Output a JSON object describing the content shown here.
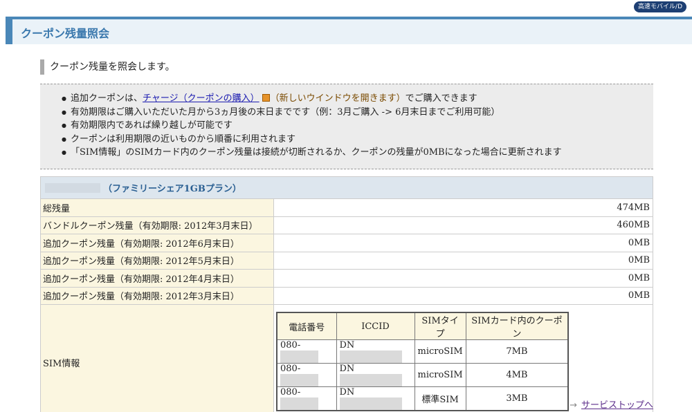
{
  "header": {
    "badge": "高速モバイル/D",
    "title": "クーポン残量照会"
  },
  "intro": "クーポン残量を照会します。",
  "notes": {
    "line1_prefix": "追加クーポンは、",
    "line1_link": "チャージ（クーポンの購入）",
    "line1_paren": "（新しいウインドウを開きます）",
    "line1_suffix": "でご購入できます",
    "line2": "有効期限はご購入いただいた月から3ヵ月後の末日までです（例：3月ご購入 -> 6月末日までご利用可能）",
    "line3": "有効期限内であれば繰り越しが可能です",
    "line4": "クーポンは利用期限の近いものから順番に利用されます",
    "line5": "「SIM情報」のSIMカード内のクーポン残量は接続が切断されるか、クーポンの残量が0MBになった場合に更新されます"
  },
  "plan": {
    "name": "（ファミリーシェア1GBプラン）"
  },
  "rows": [
    {
      "label": "総残量",
      "value": "474MB"
    },
    {
      "label": "バンドルクーポン残量（有効期限: 2012年3月末日）",
      "value": "460MB"
    },
    {
      "label": "追加クーポン残量（有効期限: 2012年6月末日）",
      "value": "0MB"
    },
    {
      "label": "追加クーポン残量（有効期限: 2012年5月末日）",
      "value": "0MB"
    },
    {
      "label": "追加クーポン残量（有効期限: 2012年4月末日）",
      "value": "0MB"
    },
    {
      "label": "追加クーポン残量（有効期限: 2012年3月末日）",
      "value": "0MB"
    }
  ],
  "sim": {
    "label": "SIM情報",
    "headers": [
      "電話番号",
      "ICCID",
      "SIMタイプ",
      "SIMカード内のクーポン"
    ],
    "rows": [
      {
        "phone": "080-",
        "iccid": "DN",
        "type": "microSIM",
        "coupon": "7MB"
      },
      {
        "phone": "080-",
        "iccid": "DN",
        "type": "microSIM",
        "coupon": "4MB"
      },
      {
        "phone": "080-",
        "iccid": "DN",
        "type": "標準SIM",
        "coupon": "3MB"
      }
    ]
  },
  "footer": {
    "link": "サービストップへ"
  }
}
